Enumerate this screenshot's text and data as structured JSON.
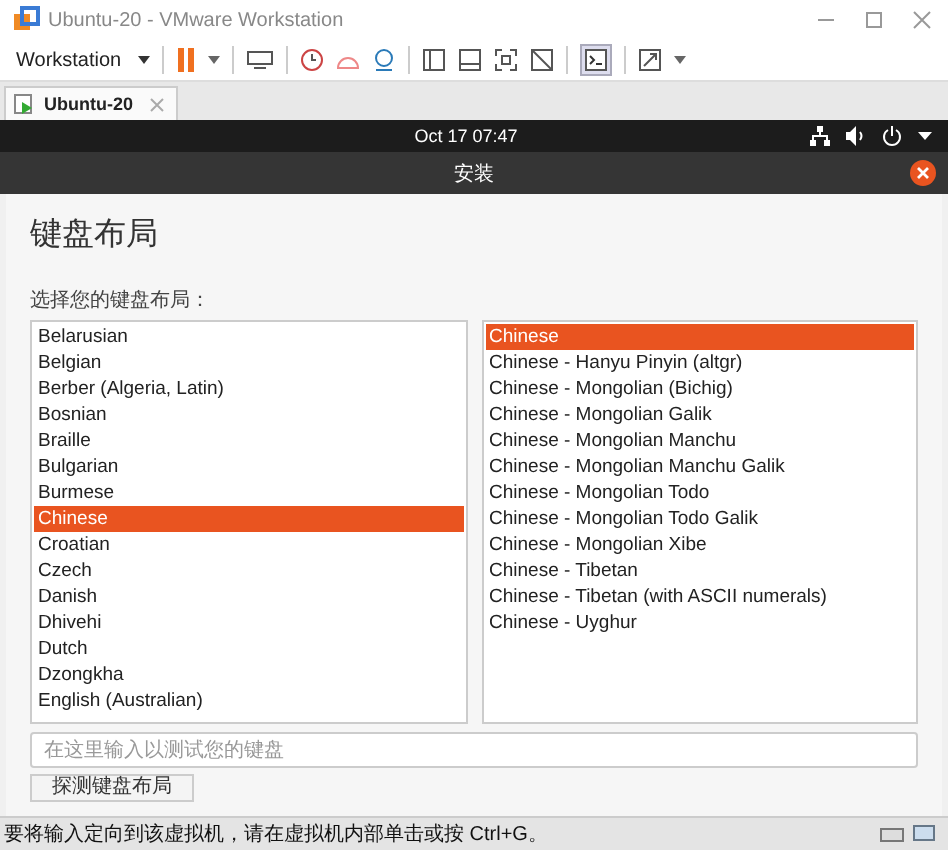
{
  "window": {
    "title": "Ubuntu-20 - VMware Workstation"
  },
  "toolbar": {
    "menu": "Workstation"
  },
  "tabs": [
    {
      "label": "Ubuntu-20",
      "selected": true
    }
  ],
  "top_bar": {
    "clock": "Oct 17  07:47"
  },
  "installer": {
    "title": "安装",
    "heading": "键盘布局",
    "prompt": "选择您的键盘布局：",
    "layouts": [
      {
        "label": "Belarusian",
        "selected": false
      },
      {
        "label": "Belgian",
        "selected": false
      },
      {
        "label": "Berber (Algeria, Latin)",
        "selected": false
      },
      {
        "label": "Bosnian",
        "selected": false
      },
      {
        "label": "Braille",
        "selected": false
      },
      {
        "label": "Bulgarian",
        "selected": false
      },
      {
        "label": "Burmese",
        "selected": false
      },
      {
        "label": "Chinese",
        "selected": true
      },
      {
        "label": "Croatian",
        "selected": false
      },
      {
        "label": "Czech",
        "selected": false
      },
      {
        "label": "Danish",
        "selected": false
      },
      {
        "label": "Dhivehi",
        "selected": false
      },
      {
        "label": "Dutch",
        "selected": false
      },
      {
        "label": "Dzongkha",
        "selected": false
      },
      {
        "label": "English (Australian)",
        "selected": false
      }
    ],
    "variants": [
      {
        "label": "Chinese",
        "selected": true
      },
      {
        "label": "Chinese - Hanyu Pinyin (altgr)",
        "selected": false
      },
      {
        "label": "Chinese - Mongolian (Bichig)",
        "selected": false
      },
      {
        "label": "Chinese - Mongolian Galik",
        "selected": false
      },
      {
        "label": "Chinese - Mongolian Manchu",
        "selected": false
      },
      {
        "label": "Chinese - Mongolian Manchu Galik",
        "selected": false
      },
      {
        "label": "Chinese - Mongolian Todo",
        "selected": false
      },
      {
        "label": "Chinese - Mongolian Todo Galik",
        "selected": false
      },
      {
        "label": "Chinese - Mongolian Xibe",
        "selected": false
      },
      {
        "label": "Chinese - Tibetan",
        "selected": false
      },
      {
        "label": "Chinese - Tibetan (with ASCII numerals)",
        "selected": false
      },
      {
        "label": "Chinese - Uyghur",
        "selected": false
      }
    ],
    "test_field": {
      "placeholder": "在这里输入以测试您的键盘"
    },
    "detect_button": "探测键盘布局"
  },
  "status_bar": {
    "text": "要将输入定向到该虚拟机，请在虚拟机内部单击或按 Ctrl+G。"
  }
}
